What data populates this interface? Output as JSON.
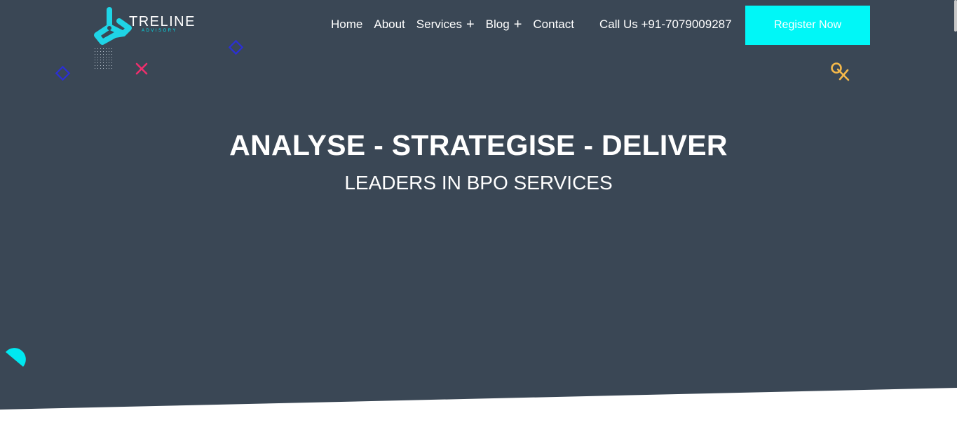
{
  "brand": {
    "name": "TRELINE",
    "tagline": "ADVISORY"
  },
  "nav": {
    "items": [
      {
        "label": "Home",
        "has_submenu": false
      },
      {
        "label": "About",
        "has_submenu": false
      },
      {
        "label": "Services",
        "has_submenu": true
      },
      {
        "label": "Blog",
        "has_submenu": true
      },
      {
        "label": "Contact",
        "has_submenu": false
      }
    ],
    "submenu_icon": "plus-icon",
    "submenu_glyph": "+"
  },
  "header": {
    "call_text": "Call Us +91-7079009287",
    "cta_label": "Register Now"
  },
  "hero": {
    "title": "ANALYSE - STRATEGISE - DELIVER",
    "subtitle": "LEADERS IN BPO SERVICES"
  },
  "colors": {
    "hero_bg": "#3a4755",
    "accent": "#00f7f7",
    "logo_teal": "#1fd4e6",
    "shape_blue": "#2b2fd6",
    "shape_pink": "#ee2f6d",
    "shape_yellow": "#f5b94a",
    "page_bg": "#ffffff"
  }
}
